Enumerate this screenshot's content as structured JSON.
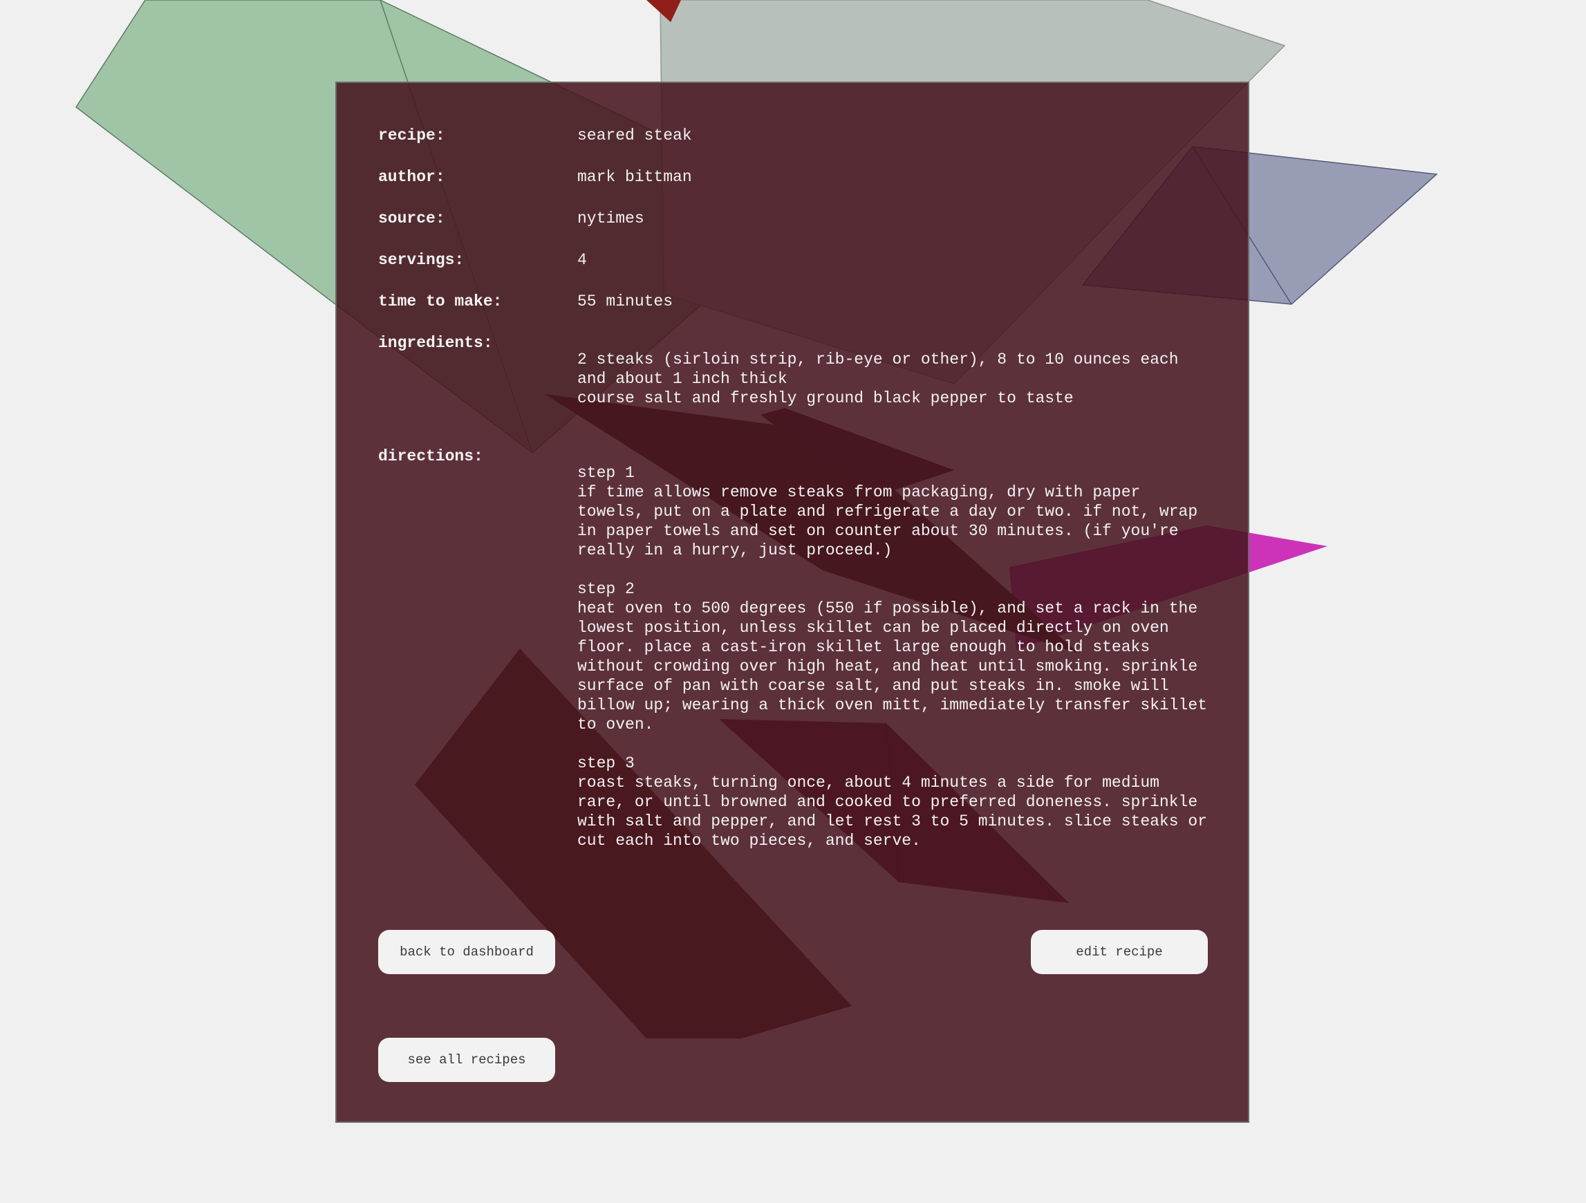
{
  "recipe": {
    "recipe_label": "recipe:",
    "recipe_value": "seared steak",
    "author_label": "author:",
    "author_value": "mark bittman",
    "source_label": "source:",
    "source_value": "nytimes",
    "servings_label": "servings:",
    "servings_value": "4",
    "time_label": "time to make:",
    "time_value": "55 minutes",
    "ingredients_label": "ingredients:",
    "ingredients": [
      "2 steaks (sirloin strip, rib-eye or other), 8 to 10 ounces each and about 1 inch thick",
      "course salt and freshly ground black pepper to taste"
    ],
    "directions_label": "directions:",
    "directions": [
      {
        "title": "step 1",
        "text": "if time allows remove steaks from packaging, dry with paper towels, put on a plate and refrigerate a day or two. if not, wrap in paper towels and set on counter about 30 minutes. (if you're really in a hurry, just proceed.)"
      },
      {
        "title": "step 2",
        "text": "heat oven to 500 degrees (550 if possible), and set a rack in the lowest position, unless skillet can be placed directly on oven floor. place a cast-iron skillet large enough to hold steaks without crowding over high heat, and heat until smoking. sprinkle surface of pan with coarse salt, and put steaks in. smoke will billow up; wearing a thick oven mitt, immediately transfer skillet to oven."
      },
      {
        "title": "step 3",
        "text": "roast steaks, turning once, about 4 minutes a side for medium rare, or until browned and cooked to preferred doneness. sprinkle with salt and pepper, and let rest 3 to 5 minutes. slice steaks or cut each into two pieces, and serve."
      }
    ]
  },
  "buttons": {
    "back_to_dashboard": "back to dashboard",
    "edit_recipe": "edit recipe",
    "see_all_recipes": "see all recipes"
  },
  "colors": {
    "page_background": "#f0f0f0",
    "panel_background": "#4a1820",
    "panel_border": "#6b6b6b",
    "text": "#f2f2f2",
    "button_background": "#f2f2f2",
    "button_text": "#3a3a3a"
  }
}
